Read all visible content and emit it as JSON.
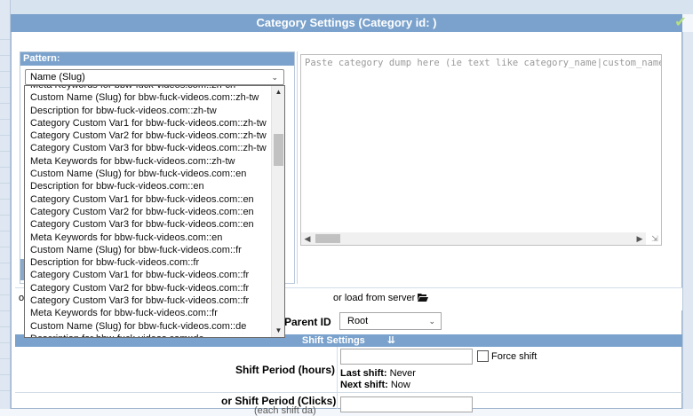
{
  "title": "Category Settings (Category id: )",
  "pattern": {
    "label": "Pattern:",
    "selected": "Name (Slug)",
    "options": [
      "Meta Keywords for bbw-fuck-videos.com::zh-cn",
      "Custom Name (Slug) for bbw-fuck-videos.com::zh-tw",
      "Description for bbw-fuck-videos.com::zh-tw",
      "Category Custom Var1 for bbw-fuck-videos.com::zh-tw",
      "Category Custom Var2 for bbw-fuck-videos.com::zh-tw",
      "Category Custom Var3 for bbw-fuck-videos.com::zh-tw",
      "Meta Keywords for bbw-fuck-videos.com::zh-tw",
      "Custom Name (Slug) for bbw-fuck-videos.com::en",
      "Description for bbw-fuck-videos.com::en",
      "Category Custom Var1 for bbw-fuck-videos.com::en",
      "Category Custom Var2 for bbw-fuck-videos.com::en",
      "Category Custom Var3 for bbw-fuck-videos.com::en",
      "Meta Keywords for bbw-fuck-videos.com::en",
      "Custom Name (Slug) for bbw-fuck-videos.com::fr",
      "Description for bbw-fuck-videos.com::fr",
      "Category Custom Var1 for bbw-fuck-videos.com::fr",
      "Category Custom Var2 for bbw-fuck-videos.com::fr",
      "Category Custom Var3 for bbw-fuck-videos.com::fr",
      "Meta Keywords for bbw-fuck-videos.com::fr",
      "Custom Name (Slug) for bbw-fuck-videos.com::de",
      "Description for bbw-fuck-videos.com::de"
    ]
  },
  "dump": {
    "placeholder": "Paste category dump here (ie text like category_name|custom_name and so on)"
  },
  "load": {
    "prefix": "o",
    "server_text": "or load from server",
    "server_icon": "folder-open-icon"
  },
  "parent": {
    "label": "Parent ID",
    "selected": "Root"
  },
  "shift": {
    "bar_label": "Shift Settings",
    "bar_icon": "double-chevron-down-icon",
    "period_label": "Shift Period (hours)",
    "force_label": "Force shift",
    "last_shift_label": "Last shift:",
    "last_shift_value": "Never",
    "next_shift_label": "Next shift:",
    "next_shift_value": "Now",
    "clicks_label": "or Shift Period (Clicks)",
    "clicks_sub": "(each shift da)"
  },
  "colors": {
    "header_bg": "#7aa2cc",
    "accent_check": "#b7e07c"
  }
}
